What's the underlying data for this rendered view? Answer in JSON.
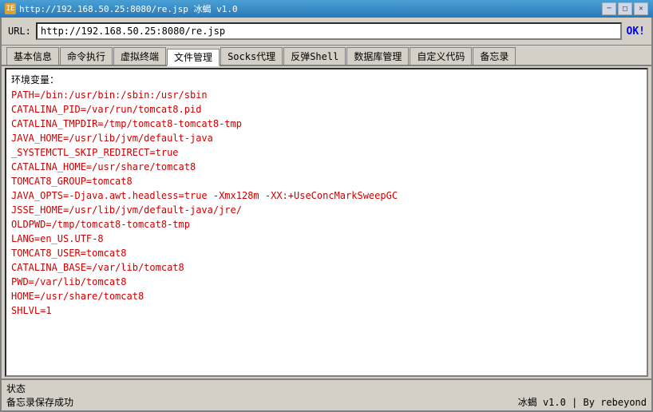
{
  "titlebar": {
    "title": "http://192.168.50.25:8080/re.jsp  冰蝎 v1.0",
    "minimize": "─",
    "maximize": "□",
    "close": "✕"
  },
  "urlbar": {
    "label": "URL:",
    "value": "http://192.168.50.25:8080/re.jsp",
    "ok": "OK!"
  },
  "tabs": [
    {
      "label": "基本信息",
      "active": false
    },
    {
      "label": "命令执行",
      "active": false
    },
    {
      "label": "虚拟终端",
      "active": false
    },
    {
      "label": "文件管理",
      "active": true
    },
    {
      "label": "Socks代理",
      "active": false
    },
    {
      "label": "反弹Shell",
      "active": false
    },
    {
      "label": "数据库管理",
      "active": false
    },
    {
      "label": "自定义代码",
      "active": false
    },
    {
      "label": "备忘录",
      "active": false
    }
  ],
  "content": {
    "section_label": "环境变量：",
    "lines": [
      "PATH=/bin:/usr/bin:/sbin:/usr/sbin",
      "CATALINA_PID=/var/run/tomcat8.pid",
      "CATALINA_TMPDIR=/tmp/tomcat8-tomcat8-tmp",
      "JAVA_HOME=/usr/lib/jvm/default-java",
      "_SYSTEMCTL_SKIP_REDIRECT=true",
      "CATALINA_HOME=/usr/share/tomcat8",
      "TOMCAT8_GROUP=tomcat8",
      "JAVA_OPTS=-Djava.awt.headless=true -Xmx128m -XX:+UseConcMarkSweepGC",
      "JSSE_HOME=/usr/lib/jvm/default-java/jre/",
      "OLDPWD=/tmp/tomcat8-tomcat8-tmp",
      "LANG=en_US.UTF-8",
      "TOMCAT8_USER=tomcat8",
      "CATALINA_BASE=/var/lib/tomcat8",
      "PWD=/var/lib/tomcat8",
      "HOME=/usr/share/tomcat8",
      "SHLVL=1"
    ]
  },
  "statusbar": {
    "state_label": "状态",
    "message": "备忘录保存成功",
    "brand": "冰蝎 v1.0  |  By rebeyond"
  }
}
